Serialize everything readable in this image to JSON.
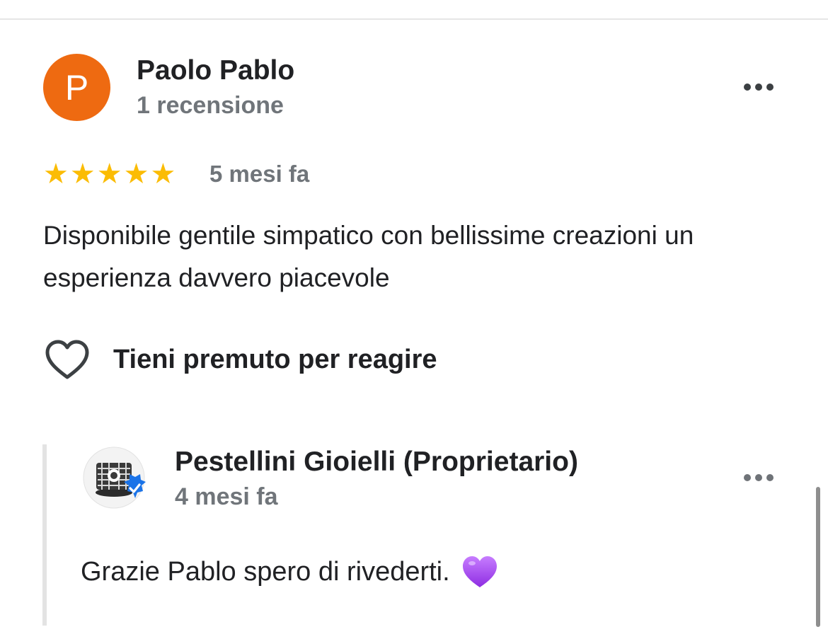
{
  "review": {
    "avatar_letter": "P",
    "avatar_color": "#ee6a11",
    "author": "Paolo Pablo",
    "meta": "1 recensione",
    "rating": 5,
    "stars": [
      "★",
      "★",
      "★",
      "★",
      "★"
    ],
    "star_color": "#fbbc04",
    "time": "5 mesi fa",
    "text": "Disponibile gentile simpatico con bellissime creazioni un esperienza davvero piacevole",
    "react_label": "Tieni premuto per reagire",
    "more_icon": "more-horizontal-icon",
    "react_icon": "heart-outline-icon"
  },
  "reply": {
    "author": "Pestellini Gioielli (Proprietario)",
    "time": "4 mesi fa",
    "text": "Grazie Pablo spero di rivederti.",
    "emoji_icon": "purple-heart-icon",
    "verified_icon": "verified-badge-icon",
    "verified_color": "#1a73e8",
    "more_icon": "more-horizontal-icon"
  }
}
